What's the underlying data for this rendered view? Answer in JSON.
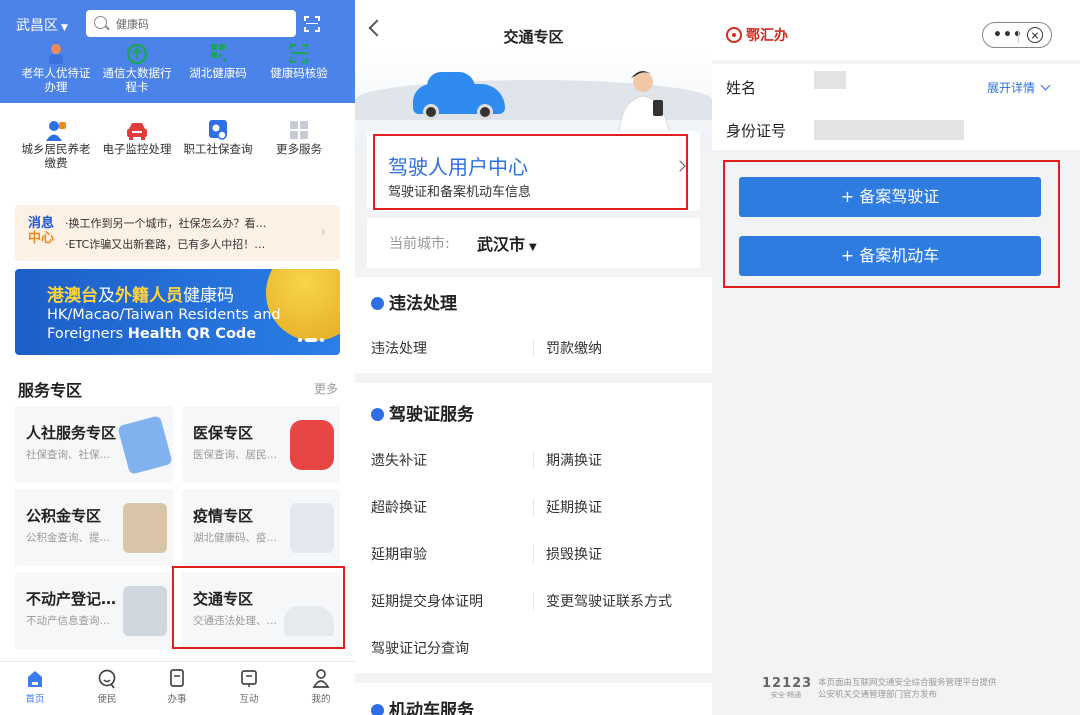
{
  "panel1": {
    "district": "武昌区",
    "search_placeholder": "健康码",
    "grid_row1": [
      {
        "label": "老年人优待证办理",
        "icon": "elder-icon"
      },
      {
        "label": "通信大数据行程卡",
        "icon": "itinerary-icon"
      },
      {
        "label": "湖北健康码",
        "icon": "qr-code-icon"
      },
      {
        "label": "健康码核验",
        "icon": "scan-verify-icon"
      }
    ],
    "grid_row2": [
      {
        "label": "城乡居民养老缴费",
        "icon": "pension-icon"
      },
      {
        "label": "电子监控处理",
        "icon": "car-icon"
      },
      {
        "label": "职工社保查询",
        "icon": "social-security-icon"
      },
      {
        "label": "更多服务",
        "icon": "more-grid-icon"
      }
    ],
    "message": {
      "tag_top": "消息",
      "tag_bottom": "中心",
      "lines": [
        "·换工作到另一个城市，社保怎么办？看…",
        "·ETC诈骗又出新套路，已有多人中招！…"
      ]
    },
    "banner": {
      "title_a": "港澳台",
      "title_b": "及",
      "title_c": "外籍人员",
      "title_d": "健康码",
      "line2": "HK/Macao/Taiwan Residents and",
      "line3a": "Foreigners ",
      "line3b": "Health QR Code"
    },
    "service_title": "服务专区",
    "service_more": "更多",
    "cards": [
      {
        "title": "人社服务专区",
        "sub": "社保查询、社保…"
      },
      {
        "title": "医保专区",
        "sub": "医保查询、居民…"
      },
      {
        "title": "公积金专区",
        "sub": "公积金查询、提…"
      },
      {
        "title": "疫情专区",
        "sub": "湖北健康码、疫…"
      },
      {
        "title": "不动产登记…",
        "sub": "不动产信息查询…"
      },
      {
        "title": "交通专区",
        "sub": "交通违法处理、…"
      }
    ],
    "tabs": [
      {
        "label": "首页",
        "icon": "home-icon"
      },
      {
        "label": "便民",
        "icon": "convenience-icon"
      },
      {
        "label": "办事",
        "icon": "affairs-icon"
      },
      {
        "label": "互动",
        "icon": "interact-icon"
      },
      {
        "label": "我的",
        "icon": "profile-icon"
      }
    ]
  },
  "panel2": {
    "title": "交通专区",
    "user_center_title": "驾驶人用户中心",
    "user_center_sub": "驾驶证和备案机动车信息",
    "city_label": "当前城市:",
    "city_value": "武汉市",
    "section1_title": "违法处理",
    "section1_items": [
      "违法处理",
      "罚款缴纳"
    ],
    "section2_title": "驾驶证服务",
    "section2_items": [
      "遗失补证",
      "期满换证",
      "超龄换证",
      "延期换证",
      "延期审验",
      "损毁换证",
      "延期提交身体证明",
      "变更驾驶证联系方式",
      "驾驶证记分查询"
    ],
    "section3_title": "机动车服务"
  },
  "panel3": {
    "logo": "鄂汇办",
    "name_label": "姓名",
    "id_label": "身份证号",
    "expand": "展开详情",
    "btn_license": "+ 备案驾驶证",
    "btn_vehicle": "+ 备案机动车",
    "footer_logo": "12123",
    "footer_logo_sub": "安全·畅通",
    "footer_line1": "本页面由互联网交通安全综合服务管理平台提供",
    "footer_line2": "公安机关交通管理部门官方发布"
  },
  "colors": {
    "primary_blue": "#2f7ce0",
    "header_blue": "#4b83e8",
    "highlight_red": "#e02020"
  }
}
